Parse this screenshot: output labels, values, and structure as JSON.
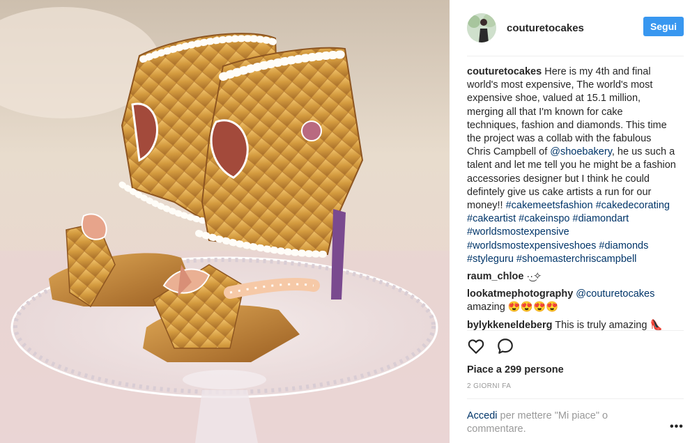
{
  "post": {
    "username": "couturetocakes",
    "follow_label": "Segui"
  },
  "caption": {
    "username": "couturetocakes",
    "text_1": " Here is my 4th and final world's most expensive, The world's most expensive shoe, valued at 15.1 million, merging all that I'm known for cake techniques, fashion and diamonds. This time the project was a collab with the fabulous Chris Campbell of ",
    "mention": "@shoebakery",
    "text_2": ", he us such a talent and let me tell you he might be a fashion accessories designer but I think he could defintely give us cake artists a run for our money!! ",
    "hashtags": "#cakemeetsfashion #cakedecorating #cakeartist #cakeinspo #diamondart #worldsmostexpensive #worldsmostexpensiveshoes #diamonds #styleguru #shoemasterchriscampbell"
  },
  "comments": [
    {
      "username": "raum_chloe",
      "text": " ·͜·✧"
    },
    {
      "username": "lookatmephotography",
      "mention": "@couturetocakes",
      "text": "amazing 😍😍😍😍"
    },
    {
      "username": "bylykkeneldeberg",
      "text": " This is truly amazing 👠"
    }
  ],
  "actions": {
    "like_icon": "heart-outline-icon",
    "comment_icon": "speech-bubble-icon"
  },
  "likes_text": "Piace a 299 persone",
  "time_ago": "2 GIORNI FA",
  "login_prompt": {
    "link": "Accedi",
    "text": " per mettere \"Mi piace\" o commentare."
  },
  "more_icon": "ellipsis-icon",
  "more_glyph": "•••",
  "colors": {
    "follow_button": "#3897f0",
    "link": "#003569",
    "muted": "#999999"
  }
}
